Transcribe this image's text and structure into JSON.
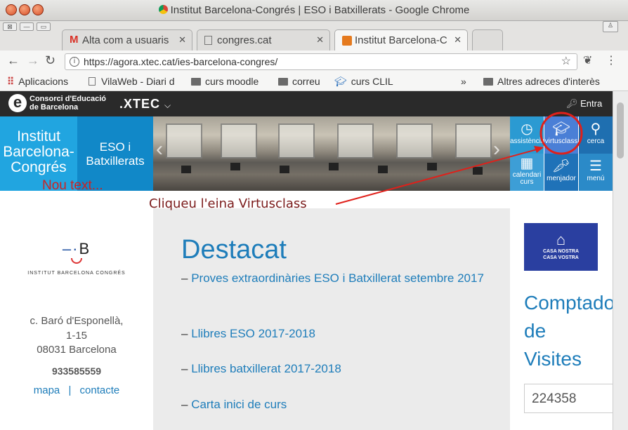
{
  "window": {
    "title": "Institut Barcelona-Congrés | ESO i Batxillerats - Google Chrome"
  },
  "tabs": [
    {
      "label": "Alta com a usuaris",
      "icon": "gmail-icon"
    },
    {
      "label": "congres.cat",
      "icon": "page-icon"
    },
    {
      "label": "Institut Barcelona-C",
      "icon": "site-favicon-icon"
    }
  ],
  "omnibox": {
    "url": "https://agora.xtec.cat/ies-barcelona-congres/"
  },
  "bookmarks": [
    {
      "label": "Aplicacions",
      "icon": "apps-icon"
    },
    {
      "label": "VilaWeb - Diari d",
      "icon": "page-icon"
    },
    {
      "label": "curs moodle",
      "icon": "folder-icon"
    },
    {
      "label": "correu",
      "icon": "folder-icon"
    },
    {
      "label": "curs CLIL",
      "icon": "moodle-icon"
    }
  ],
  "bookmarks_more": "»",
  "bookmarks_other": "Altres adreces d'interès",
  "xtec": {
    "brand_line1": "Consorci d'Educació",
    "brand_line2": "de Barcelona",
    "xtec_logo": ".XTEC",
    "login": "Entra"
  },
  "hero": {
    "school_name": [
      "Institut",
      "Barcelona-",
      "Congrés"
    ],
    "studies": [
      "ESO i",
      "Batxillerats"
    ]
  },
  "tiles": [
    {
      "label": "assistència",
      "icon": "clock-icon",
      "color": "#2b9ad2"
    },
    {
      "label": "virtusclass",
      "icon": "graduation-cap-icon",
      "color": "#4a7fd6"
    },
    {
      "label": "cerca",
      "icon": "search-icon",
      "color": "#1f6fb0"
    },
    {
      "label": "calendari curs",
      "icon": "calendar-icon",
      "color": "#3d9ed6"
    },
    {
      "label": "menjador",
      "icon": "carrot-icon",
      "color": "#1f72b8"
    },
    {
      "label": "menú",
      "icon": "hamburger-icon",
      "color": "#2b8ac8"
    }
  ],
  "sidebar": {
    "logo_text": "INSTITUT BARCELONA CONGRÉS",
    "address1": "c. Baró d'Esponellà,",
    "address2": "1-15",
    "address3": "08031 Barcelona",
    "phone": "933585559",
    "map_link": "mapa",
    "separator": "|",
    "contact_link": "contacte"
  },
  "main": {
    "heading": "Destacat",
    "news": [
      "Proves extraordinàries ESO i Batxillerat setembre 2017",
      "Llibres ESO 2017-2018",
      "Llibres batxillerat 2017-2018",
      "Carta inici de curs"
    ],
    "dash": "–"
  },
  "right": {
    "casa_line1": "CASA NOSTRA",
    "casa_line2": "CASA VOSTRA",
    "comptador": [
      "Comptador",
      "de",
      "Visites"
    ],
    "counter_value": "224358"
  },
  "annotations": {
    "placeholder": "Nou text...",
    "callout": "Cliqueu l'eina Virtusclass",
    "color": "#e0201a"
  }
}
